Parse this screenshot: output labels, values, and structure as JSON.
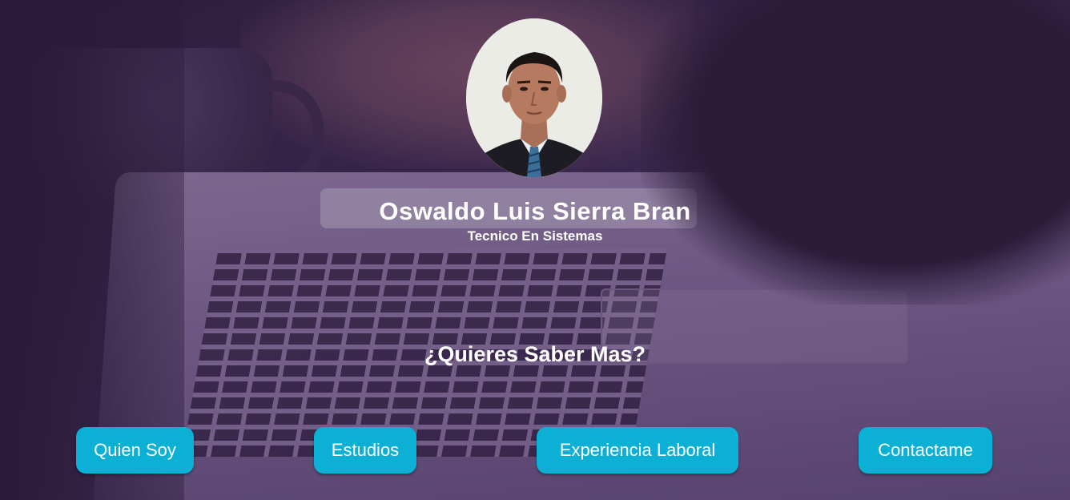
{
  "profile": {
    "name": "Oswaldo Luis Sierra Bran",
    "role": "Tecnico En Sistemas",
    "photo_icon": "profile-photo"
  },
  "cta": {
    "question": "¿Quieres Saber Mas?"
  },
  "nav": {
    "items": [
      {
        "label": "Quien Soy"
      },
      {
        "label": "Estudios"
      },
      {
        "label": "Experiencia Laboral"
      },
      {
        "label": "Contactame"
      }
    ]
  },
  "colors": {
    "button": "#0bb0d4",
    "text": "#ffffff",
    "overlay": "#2d1946"
  }
}
